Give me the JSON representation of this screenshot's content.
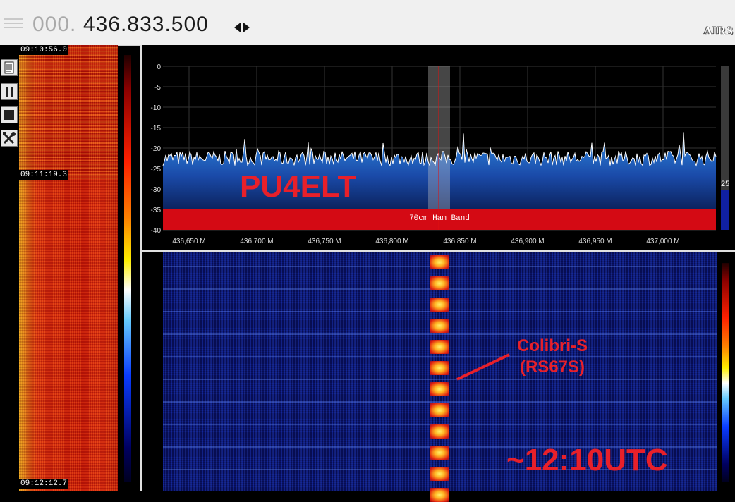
{
  "top_bar": {
    "frequency_dim": "000.",
    "frequency_main": "436.833.500",
    "logo": "AIRS"
  },
  "toolbar": {
    "icons": [
      "document-icon",
      "pause-icon",
      "stop-icon",
      "tools-icon"
    ]
  },
  "if_waterfall": {
    "timestamps": [
      "09:10:56.0",
      "09:11:19.3",
      "09:12:12.7"
    ]
  },
  "spectrum": {
    "y_ticks": [
      "0",
      "-5",
      "-10",
      "-15",
      "-20",
      "-25",
      "-30",
      "-35",
      "-40"
    ],
    "x_ticks": [
      "436,650 M",
      "436,700 M",
      "436,750 M",
      "436,800 M",
      "436,850 M",
      "436,900 M",
      "436,950 M",
      "437,000 M"
    ],
    "band_label": "70cm Ham Band",
    "scale_value": "25",
    "callsign_annotation": "PU4ELT"
  },
  "rf_waterfall": {
    "signal_label_line1": "Colibri-S",
    "signal_label_line2": "(RS67S)",
    "time_annotation": "~12:10UTC"
  },
  "colors": {
    "annotation": "#e8202a",
    "band_bar": "#d40a14",
    "spectrum_fill_top": "#2a7fd4",
    "waterfall_bg": "#0a1466"
  }
}
